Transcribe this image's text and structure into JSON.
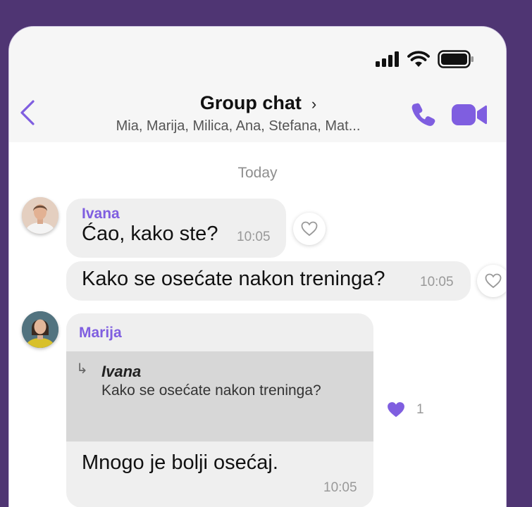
{
  "header": {
    "title": "Group chat",
    "title_chevron": "›",
    "subtitle": "Mia, Marija, Milica, Ana, Stefana, Mat..."
  },
  "chat": {
    "date_divider": "Today",
    "messages": [
      {
        "sender": "Ivana",
        "text": "Ćao, kako ste?",
        "time": "10:05"
      },
      {
        "text": "Kako se osećate nakon treninga?",
        "time": "10:05"
      },
      {
        "sender": "Marija",
        "quote": {
          "author": "Ivana",
          "text": "Kako se osećate nakon treninga?",
          "arrow": "↳"
        },
        "text": "Mnogo je bolji osećaj.",
        "time": "10:05",
        "reaction": {
          "icon": "heart-filled-icon",
          "count": "1"
        }
      }
    ]
  },
  "colors": {
    "background": "#4f3573",
    "accent": "#7f5ee0",
    "bubble": "#efefef",
    "quote": "#d7d7d7"
  },
  "icons": [
    "signal-icon",
    "wifi-icon",
    "battery-icon",
    "back-chevron-icon",
    "phone-icon",
    "video-camera-icon",
    "heart-outline-icon",
    "heart-filled-icon",
    "reply-arrow-icon"
  ]
}
